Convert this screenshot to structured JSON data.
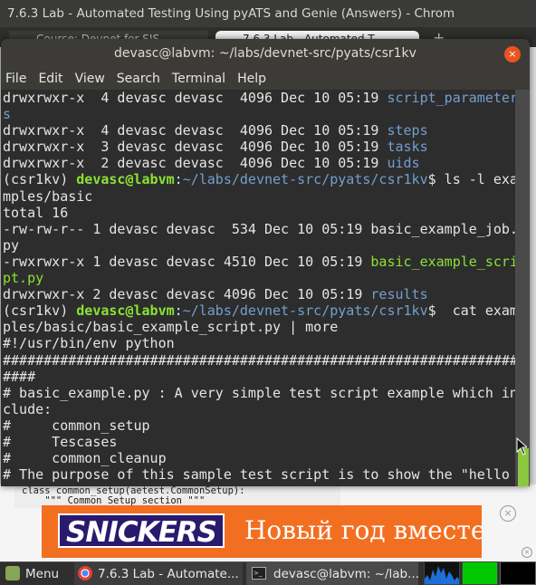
{
  "chrome": {
    "window_title": "7.6.3 Lab - Automated Testing Using pyATS and Genie (Answers) - Chrom",
    "tabs": [
      {
        "label": "Course: Devnet for SIS"
      },
      {
        "label": "7.6.3 Lab - Automated T"
      }
    ],
    "new_tab": "+",
    "code_snippet": "class common_setup(aetest.CommonSetup):\n    \"\"\" Common Setup section \"\"\"",
    "ad": {
      "logo": "SNICKERS",
      "text": "Новый год вместе",
      "info_mark": "i▷",
      "close_mark": "×"
    }
  },
  "terminal": {
    "title": "devasc@labvm: ~/labs/devnet-src/pyats/csr1kv",
    "close_mark": "×",
    "menu": [
      "File",
      "Edit",
      "View",
      "Search",
      "Terminal",
      "Help"
    ],
    "lines": [
      [
        {
          "t": "drwxrwxr-x  4 devasc devasc  4096 Dec 10 05:19 "
        },
        {
          "t": "script_parameter",
          "c": "blue"
        }
      ],
      [
        {
          "t": "s",
          "c": "blue"
        }
      ],
      [
        {
          "t": "drwxrwxr-x  4 devasc devasc  4096 Dec 10 05:19 "
        },
        {
          "t": "steps",
          "c": "blue"
        }
      ],
      [
        {
          "t": "drwxrwxr-x  3 devasc devasc  4096 Dec 10 05:19 "
        },
        {
          "t": "tasks",
          "c": "blue"
        }
      ],
      [
        {
          "t": "drwxrwxr-x  2 devasc devasc  4096 Dec 10 05:19 "
        },
        {
          "t": "uids",
          "c": "blue"
        }
      ],
      [
        {
          "t": "(csr1kv) "
        },
        {
          "t": "devasc@labvm",
          "c": "bgreen"
        },
        {
          "t": ":"
        },
        {
          "t": "~/labs/devnet-src/pyats/csr1kv",
          "c": "blue"
        },
        {
          "t": "$ ls -l exa"
        }
      ],
      [
        {
          "t": "mples/basic"
        }
      ],
      [
        {
          "t": "total 16"
        }
      ],
      [
        {
          "t": "-rw-rw-r-- 1 devasc devasc  534 Dec 10 05:19 basic_example_job."
        }
      ],
      [
        {
          "t": "py"
        }
      ],
      [
        {
          "t": "-rwxrwxr-x 1 devasc devasc 4510 Dec 10 05:19 "
        },
        {
          "t": "basic_example_scri",
          "c": "green"
        }
      ],
      [
        {
          "t": "pt.py",
          "c": "green"
        }
      ],
      [
        {
          "t": "drwxrwxr-x 2 devasc devasc 4096 Dec 10 05:19 "
        },
        {
          "t": "results",
          "c": "blue"
        }
      ],
      [
        {
          "t": "(csr1kv) "
        },
        {
          "t": "devasc@labvm",
          "c": "bgreen"
        },
        {
          "t": ":"
        },
        {
          "t": "~/labs/devnet-src/pyats/csr1kv",
          "c": "blue"
        },
        {
          "t": "$  cat exam"
        }
      ],
      [
        {
          "t": "ples/basic/basic_example_script.py | more"
        }
      ],
      [
        {
          "t": "#!/usr/bin/env python"
        }
      ],
      [
        {
          "t": "###############################################################"
        }
      ],
      [
        {
          "t": "####"
        }
      ],
      [
        {
          "t": "# basic_example.py : A very simple test script example which in"
        }
      ],
      [
        {
          "t": "clude:"
        }
      ],
      [
        {
          "t": "#     common_setup"
        }
      ],
      [
        {
          "t": "#     Tescases"
        }
      ],
      [
        {
          "t": "#     common_cleanup"
        }
      ],
      [
        {
          "t": "# The purpose of this sample test script is to show the \"hello"
        }
      ]
    ]
  },
  "taskbar": {
    "menu_label": "Menu",
    "chrome_label": "7.6.3 Lab - Automate...",
    "terminal_label": "devasc@labvm: ~/lab...",
    "terminal_icon_text": ">_"
  }
}
